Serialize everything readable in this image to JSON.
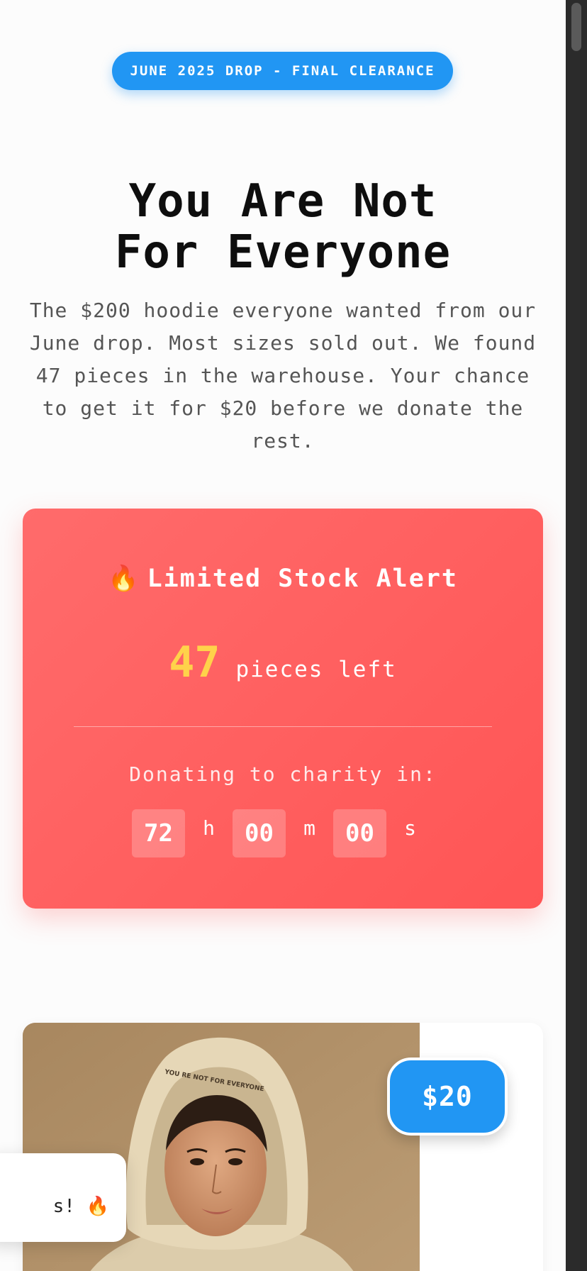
{
  "banner": {
    "label": "JUNE 2025 DROP - FINAL CLEARANCE"
  },
  "hero": {
    "title_line1": "You Are Not",
    "title_line2": "For Everyone",
    "description": "The $200 hoodie everyone wanted from our June drop. Most sizes sold out. We found 47 pieces in the warehouse. Your chance to get it for $20 before we donate the rest."
  },
  "stock_alert": {
    "icon": "fire-icon",
    "title": "Limited Stock Alert",
    "count": "47",
    "count_label": "pieces left",
    "donate_label": "Donating to charity in:",
    "countdown": {
      "hours": "72",
      "hours_unit": "h",
      "minutes": "00",
      "minutes_unit": "m",
      "seconds": "00",
      "seconds_unit": "s"
    }
  },
  "product": {
    "price": "$20",
    "hood_print": "YOU RE NOT FOR EVERYONE"
  },
  "toast": {
    "text": "s! 🔥"
  },
  "colors": {
    "accent": "#2196f3",
    "alert": "#ff5a5a",
    "count": "#ffd24a"
  }
}
